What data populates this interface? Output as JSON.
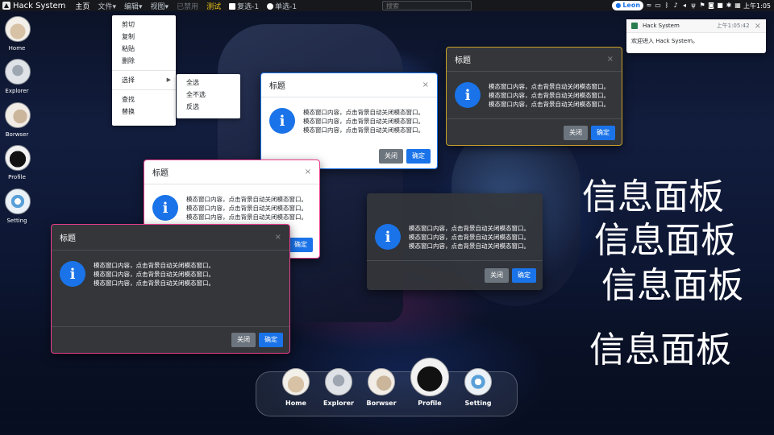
{
  "colors": {
    "accent": "#1a73e8",
    "topbar": "#16181c",
    "test": "#f0c419"
  },
  "topbar": {
    "brand": "Hack System",
    "menu": {
      "home": "主页",
      "file": "文件",
      "edit": "编辑",
      "view": "视图",
      "disabled": "已禁用",
      "test": "测试",
      "checkbox": "复选-1",
      "radio": "单选-1"
    },
    "search_placeholder": "搜索",
    "user": "Leon",
    "clock": "上午1:05"
  },
  "side_dock": [
    {
      "label": "Home",
      "icon": "home-icon"
    },
    {
      "label": "Explorer",
      "icon": "explorer-icon"
    },
    {
      "label": "Borwser",
      "icon": "browser-icon"
    },
    {
      "label": "Profile",
      "icon": "profile-icon"
    },
    {
      "label": "Setting",
      "icon": "setting-icon"
    }
  ],
  "edit_menu": {
    "items": [
      "剪切",
      "复制",
      "粘贴",
      "删除",
      "选择",
      "查找",
      "替换"
    ],
    "submenu": [
      "全选",
      "全不选",
      "反选"
    ]
  },
  "modal": {
    "title": "标题",
    "line": "模态窗口内容，点击背景自动关闭模态窗口。",
    "close": "关闭",
    "ok": "确定",
    "x": "×"
  },
  "notification": {
    "app": "Hack System",
    "time": "上午1:05:42",
    "message": "欢迎进入 Hack System。"
  },
  "panel_text": "信息面板",
  "bottom_dock": [
    {
      "label": "Home",
      "icon": "home-icon"
    },
    {
      "label": "Explorer",
      "icon": "explorer-icon"
    },
    {
      "label": "Borwser",
      "icon": "browser-icon"
    },
    {
      "label": "Profile",
      "icon": "profile-icon"
    },
    {
      "label": "Setting",
      "icon": "setting-icon"
    }
  ]
}
